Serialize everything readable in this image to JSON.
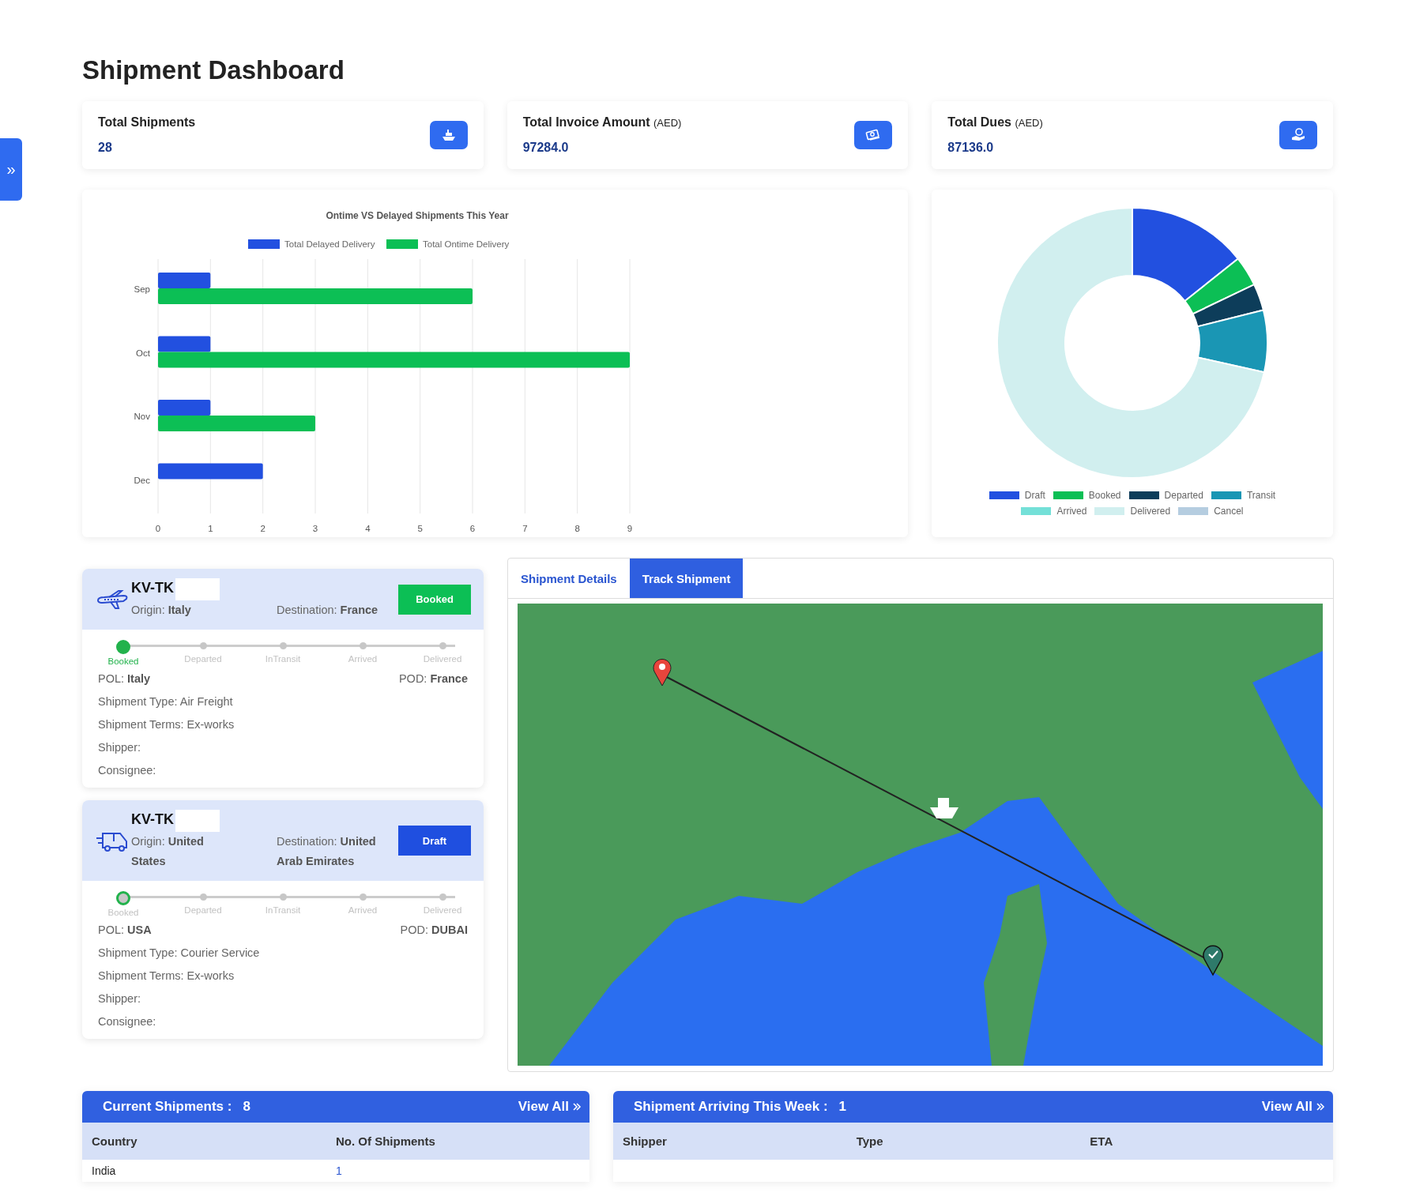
{
  "page_title": "Shipment Dashboard",
  "sidebar_toggle": {
    "icon": "»"
  },
  "stats": [
    {
      "kind": "ship",
      "label": "Total Shipments",
      "value": "28"
    },
    {
      "kind": "money",
      "label": "Total Invoice Amount",
      "unit": "(AED)",
      "value": "97284.0"
    },
    {
      "kind": "dues",
      "label": "Total Dues",
      "unit": "(AED)",
      "value": "87136.0"
    }
  ],
  "bar_chart": {
    "chart_data": {
      "type": "bar",
      "orientation": "horizontal",
      "title": "Ontime VS Delayed Shipments This Year",
      "categories": [
        "Sep",
        "Oct",
        "Nov",
        "Dec"
      ],
      "series": [
        {
          "name": "Total Delayed Delivery",
          "color": "#2250e0",
          "values": [
            1,
            1,
            1,
            2
          ]
        },
        {
          "name": "Total Ontime Delivery",
          "color": "#0cbf55",
          "values": [
            6,
            9,
            3,
            0
          ]
        }
      ],
      "xlim": [
        0,
        9
      ],
      "grid": true,
      "legend": true,
      "xticks": [
        0,
        1,
        2,
        3,
        4,
        5,
        6,
        7,
        8,
        9
      ]
    }
  },
  "status_chart": {
    "legend": [
      {
        "label": "Draft",
        "color": "#2250e0"
      },
      {
        "label": "Booked",
        "color": "#0cbf55"
      },
      {
        "label": "Departed",
        "color": "#0d3d5a"
      },
      {
        "label": "Transit",
        "color": "#1a96b4"
      },
      {
        "label": "Arrived",
        "color": "#74e0d8"
      },
      {
        "label": "Delivered",
        "color": "#d1efef"
      },
      {
        "label": "Cancel",
        "color": "#b5cde0"
      }
    ]
  },
  "shipments": [
    {
      "kind": "air",
      "id": "KV-TK",
      "origin": "Origin: **Italy**",
      "destination": "Destination: **France**",
      "status": "Booked",
      "color": "#0cbf55",
      "steps": [
        {
          "label": "Booked",
          "completed": true,
          "current": true
        },
        {
          "label": "Departed",
          "completed": false,
          "current": false
        },
        {
          "label": "InTransit",
          "completed": false,
          "current": false
        },
        {
          "label": "Arrived",
          "completed": false,
          "current": false
        },
        {
          "label": "Delivered",
          "completed": false,
          "current": false
        }
      ],
      "pol": "POL: **Italy**",
      "pod": "POD: **France**",
      "details": [
        "Shipment Type: Air Freight",
        "Shipment Terms: Ex-works",
        "Shipper:",
        "Consignee:"
      ]
    },
    {
      "kind": "road",
      "id": "KV-TK",
      "origin": "Origin: **United States**",
      "destination": "Destination: **United Arab Emirates**",
      "status": "Draft",
      "color": "#1f4fe0",
      "steps": [
        {
          "label": "Booked",
          "completed": false,
          "current": true
        },
        {
          "label": "Departed",
          "completed": false,
          "current": false
        },
        {
          "label": "InTransit",
          "completed": false,
          "current": false
        },
        {
          "label": "Arrived",
          "completed": false,
          "current": false
        },
        {
          "label": "Delivered",
          "completed": false,
          "current": false
        }
      ],
      "pol": "POL: **USA**",
      "pod": "POD: **DUBAI**",
      "details": [
        "Shipment Type: Courier Service",
        "Shipment Terms: Ex-works",
        "Shipper:",
        "Consignee:"
      ]
    }
  ],
  "tabs": [
    {
      "label": "Shipment Details",
      "selected": false
    },
    {
      "label": "Track Shipment",
      "selected": true
    }
  ],
  "tables": [
    {
      "title": "Current Shipments :",
      "count": "8",
      "link": "View All",
      "columns": [
        "Country",
        "No. Of Shipments"
      ],
      "rows": [
        [
          "India",
          "1"
        ]
      ]
    },
    {
      "title": "Shipment Arriving This Week :",
      "count": "1",
      "link": "View All",
      "columns": [
        "Shipper",
        "Type",
        "ETA"
      ]
    }
  ]
}
